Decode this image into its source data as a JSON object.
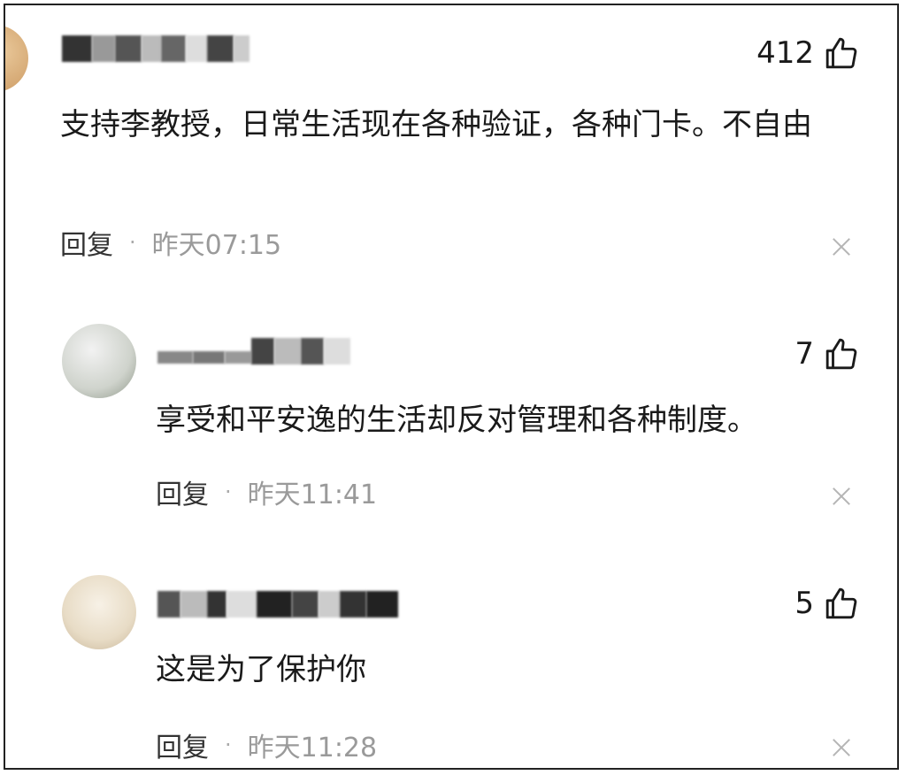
{
  "comments": [
    {
      "username": "",
      "likes": "412",
      "text": "支持李教授，日常生活现在各种验证，各种门卡。不自由",
      "reply_label": "回复",
      "separator": "·",
      "time": "昨天07:15"
    },
    {
      "username": "",
      "likes": "7",
      "text": "享受和平安逸的生活却反对管理和各种制度。",
      "reply_label": "回复",
      "separator": "·",
      "time": "昨天11:41"
    },
    {
      "username": "",
      "likes": "5",
      "text": "这是为了保护你",
      "reply_label": "回复",
      "separator": "·",
      "time": "昨天11:28"
    }
  ],
  "icons": {
    "like": "thumbs-up-icon",
    "dismiss": "close-icon"
  },
  "colors": {
    "text": "#1a1a1a",
    "timestamp": "#9a9a9a",
    "close": "#b5b5b5"
  }
}
